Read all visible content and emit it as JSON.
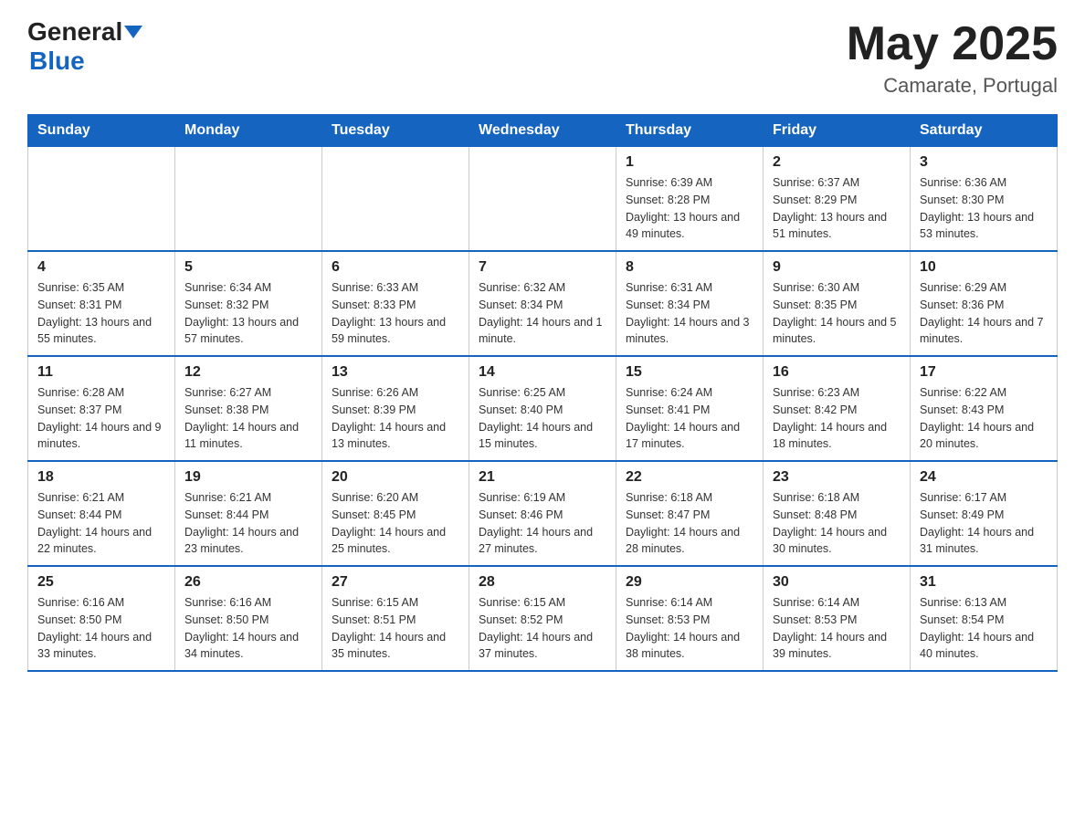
{
  "header": {
    "logo_general": "General",
    "logo_blue": "Blue",
    "month_year": "May 2025",
    "location": "Camarate, Portugal"
  },
  "weekdays": [
    "Sunday",
    "Monday",
    "Tuesday",
    "Wednesday",
    "Thursday",
    "Friday",
    "Saturday"
  ],
  "rows": [
    [
      {
        "day": "",
        "info": ""
      },
      {
        "day": "",
        "info": ""
      },
      {
        "day": "",
        "info": ""
      },
      {
        "day": "",
        "info": ""
      },
      {
        "day": "1",
        "info": "Sunrise: 6:39 AM\nSunset: 8:28 PM\nDaylight: 13 hours and 49 minutes."
      },
      {
        "day": "2",
        "info": "Sunrise: 6:37 AM\nSunset: 8:29 PM\nDaylight: 13 hours and 51 minutes."
      },
      {
        "day": "3",
        "info": "Sunrise: 6:36 AM\nSunset: 8:30 PM\nDaylight: 13 hours and 53 minutes."
      }
    ],
    [
      {
        "day": "4",
        "info": "Sunrise: 6:35 AM\nSunset: 8:31 PM\nDaylight: 13 hours and 55 minutes."
      },
      {
        "day": "5",
        "info": "Sunrise: 6:34 AM\nSunset: 8:32 PM\nDaylight: 13 hours and 57 minutes."
      },
      {
        "day": "6",
        "info": "Sunrise: 6:33 AM\nSunset: 8:33 PM\nDaylight: 13 hours and 59 minutes."
      },
      {
        "day": "7",
        "info": "Sunrise: 6:32 AM\nSunset: 8:34 PM\nDaylight: 14 hours and 1 minute."
      },
      {
        "day": "8",
        "info": "Sunrise: 6:31 AM\nSunset: 8:34 PM\nDaylight: 14 hours and 3 minutes."
      },
      {
        "day": "9",
        "info": "Sunrise: 6:30 AM\nSunset: 8:35 PM\nDaylight: 14 hours and 5 minutes."
      },
      {
        "day": "10",
        "info": "Sunrise: 6:29 AM\nSunset: 8:36 PM\nDaylight: 14 hours and 7 minutes."
      }
    ],
    [
      {
        "day": "11",
        "info": "Sunrise: 6:28 AM\nSunset: 8:37 PM\nDaylight: 14 hours and 9 minutes."
      },
      {
        "day": "12",
        "info": "Sunrise: 6:27 AM\nSunset: 8:38 PM\nDaylight: 14 hours and 11 minutes."
      },
      {
        "day": "13",
        "info": "Sunrise: 6:26 AM\nSunset: 8:39 PM\nDaylight: 14 hours and 13 minutes."
      },
      {
        "day": "14",
        "info": "Sunrise: 6:25 AM\nSunset: 8:40 PM\nDaylight: 14 hours and 15 minutes."
      },
      {
        "day": "15",
        "info": "Sunrise: 6:24 AM\nSunset: 8:41 PM\nDaylight: 14 hours and 17 minutes."
      },
      {
        "day": "16",
        "info": "Sunrise: 6:23 AM\nSunset: 8:42 PM\nDaylight: 14 hours and 18 minutes."
      },
      {
        "day": "17",
        "info": "Sunrise: 6:22 AM\nSunset: 8:43 PM\nDaylight: 14 hours and 20 minutes."
      }
    ],
    [
      {
        "day": "18",
        "info": "Sunrise: 6:21 AM\nSunset: 8:44 PM\nDaylight: 14 hours and 22 minutes."
      },
      {
        "day": "19",
        "info": "Sunrise: 6:21 AM\nSunset: 8:44 PM\nDaylight: 14 hours and 23 minutes."
      },
      {
        "day": "20",
        "info": "Sunrise: 6:20 AM\nSunset: 8:45 PM\nDaylight: 14 hours and 25 minutes."
      },
      {
        "day": "21",
        "info": "Sunrise: 6:19 AM\nSunset: 8:46 PM\nDaylight: 14 hours and 27 minutes."
      },
      {
        "day": "22",
        "info": "Sunrise: 6:18 AM\nSunset: 8:47 PM\nDaylight: 14 hours and 28 minutes."
      },
      {
        "day": "23",
        "info": "Sunrise: 6:18 AM\nSunset: 8:48 PM\nDaylight: 14 hours and 30 minutes."
      },
      {
        "day": "24",
        "info": "Sunrise: 6:17 AM\nSunset: 8:49 PM\nDaylight: 14 hours and 31 minutes."
      }
    ],
    [
      {
        "day": "25",
        "info": "Sunrise: 6:16 AM\nSunset: 8:50 PM\nDaylight: 14 hours and 33 minutes."
      },
      {
        "day": "26",
        "info": "Sunrise: 6:16 AM\nSunset: 8:50 PM\nDaylight: 14 hours and 34 minutes."
      },
      {
        "day": "27",
        "info": "Sunrise: 6:15 AM\nSunset: 8:51 PM\nDaylight: 14 hours and 35 minutes."
      },
      {
        "day": "28",
        "info": "Sunrise: 6:15 AM\nSunset: 8:52 PM\nDaylight: 14 hours and 37 minutes."
      },
      {
        "day": "29",
        "info": "Sunrise: 6:14 AM\nSunset: 8:53 PM\nDaylight: 14 hours and 38 minutes."
      },
      {
        "day": "30",
        "info": "Sunrise: 6:14 AM\nSunset: 8:53 PM\nDaylight: 14 hours and 39 minutes."
      },
      {
        "day": "31",
        "info": "Sunrise: 6:13 AM\nSunset: 8:54 PM\nDaylight: 14 hours and 40 minutes."
      }
    ]
  ]
}
